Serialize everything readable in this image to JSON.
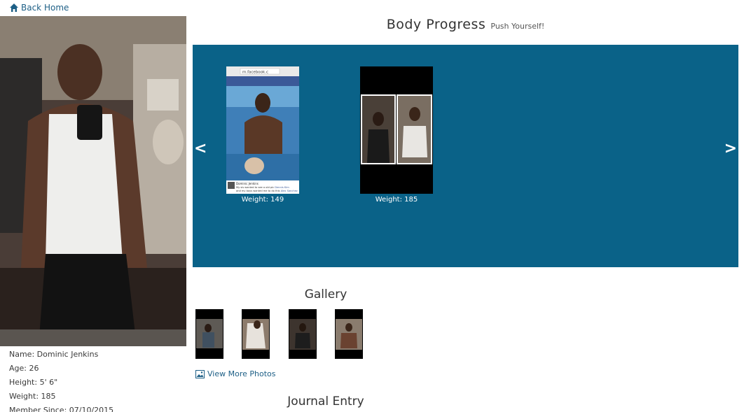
{
  "nav": {
    "back_label": "Back Home",
    "back_icon": "home-icon"
  },
  "profile": {
    "name_row": "Name: Dominic Jenkins",
    "age_row": "Age: 26",
    "height_row": "Height: 5' 6\"",
    "weight_row": "Weight: 185",
    "member_row": "Member Since: 07/10/2015"
  },
  "progress": {
    "title": "Body Progress",
    "subtitle": "Push Yourself!"
  },
  "carousel": {
    "prev_label": "<",
    "next_label": ">",
    "slides": [
      {
        "caption": "Weight: 149",
        "url_text": "m.facebook.c",
        "post_name": "Dominic Jenkins",
        "post_text": "My sis wanted to see a old pic",
        "post_link": "Dennis Kim",
        "post_text2": "and my boys wanted me to do this",
        "post_link2": "Alex Sanchez"
      },
      {
        "caption": "Weight: 185"
      }
    ]
  },
  "gallery": {
    "title": "Gallery",
    "view_more_label": "View More Photos",
    "view_more_icon": "image-icon"
  },
  "journal": {
    "title": "Journal Entry"
  },
  "colors": {
    "accent": "#0a6288",
    "link": "#1d5f86"
  }
}
